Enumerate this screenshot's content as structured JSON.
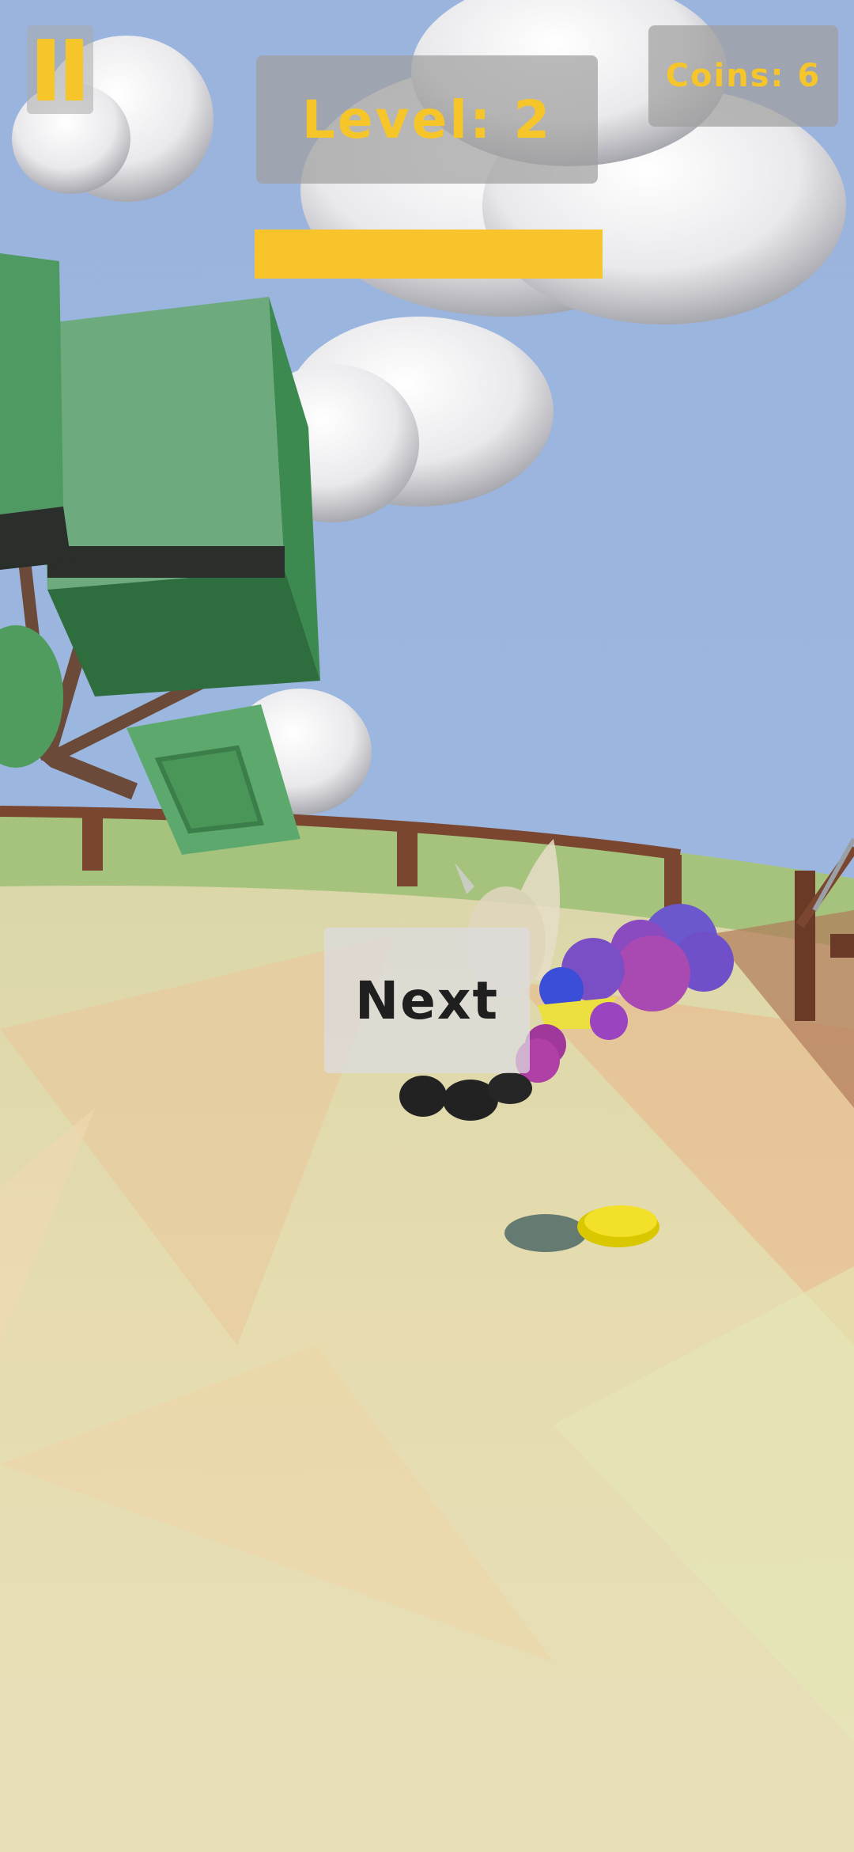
{
  "hud": {
    "level_text": "Level: 2",
    "coins_text": "Coins: 6",
    "level_progress": 1.0
  },
  "buttons": {
    "next_label": "Next"
  },
  "icons": {
    "pause": "pause-icon"
  },
  "colors": {
    "hud_accent": "#f5c52a",
    "sky": "#98b3dd",
    "ground": "#e8dcb4"
  }
}
